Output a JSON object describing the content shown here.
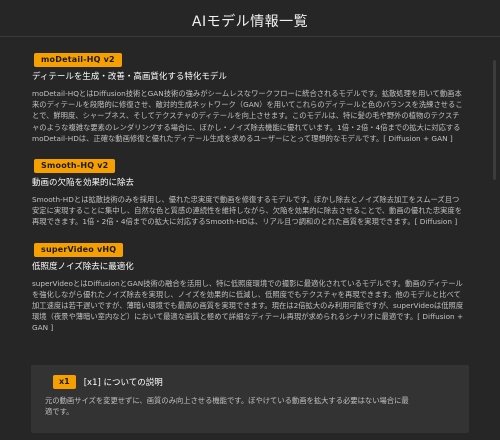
{
  "dialog": {
    "title": "AIモデル情報一覧"
  },
  "models": [
    {
      "badge": "moDetail-HQ  v2",
      "heading": "ディテールを生成・改善・高画質化する特化モデル",
      "description": "moDetail-HQとはDiffusion技術とGAN技術の強みがシームレスなワークフローに統合されるモデルです。拡散処理を用いて動画本来のディテールを段階的に修復させ、敵対的生成ネットワーク（GAN）を用いてこれらのディテールと色のバランスを洗練させることで、鮮明度、シャープネス、そしてテクスチャのディテールを向上させます。このモデルは、特に髪の毛や野外の植物のテクスチャのような複雑な要素のレンダリングする場合に、ぼかし・ノイズ除去機能に優れています。1倍・2倍・4倍までの拡大に対応するmoDetail-HDは、正確な動画修復と優れたディテール生成を求めるユーザーにとって理想的なモデルです。[ Diffusion + GAN ]"
    },
    {
      "badge": "Smooth-HQ  v2",
      "heading": "動画の欠陥を効果的に除去",
      "description": "Smooth-HDとは拡散技術のみを採用し、優れた忠実度で動画を修復するモデルです。ぼかし除去とノイズ除去加工をスムーズ且つ安定に実現することに集中し、自然な色と質感の連続性を維持しながら、欠陥を効果的に除去させることで、動画の優れた忠実度を再現できます。1倍・2倍・4倍までの拡大に対応するSmooth-HDは、リアル且つ調和のとれた画質を実現できます。[ Diffusion ]"
    },
    {
      "badge": "superVideo vHQ",
      "heading": "低照度ノイズ除去に最適化",
      "description": "superVideoとはDiffusionとGAN技術の融合を活用し、特に低照度環境での撮影に最適化されているモデルです。動画のディテールを強化しながら優れたノイズ除去を実現し、ノイズを効果的に低減し、低照度でもテクスチャを再現できます。他のモデルと比べて加工速度は若干遅いですが、薄暗い環境でも最高の画質を実現できます。現在は2倍拡大のみ利用可能ですが、superVideoは低照度環境（夜景や薄暗い室内など）において最適な画質と極めて詳細なディテール再現が求められるシナリオに最適です。[ Diffusion + GAN ]"
    }
  ],
  "info": {
    "badge": "x1",
    "title": "[x1] についての説明",
    "text": "元の動画サイズを変更せずに、画質のみ向上させる機能です。ぼやけている動画を拡大する必要はない場合に最適です。"
  },
  "colors": {
    "accent": "#f5a000",
    "background": "#262626",
    "info_box": "#333333"
  }
}
